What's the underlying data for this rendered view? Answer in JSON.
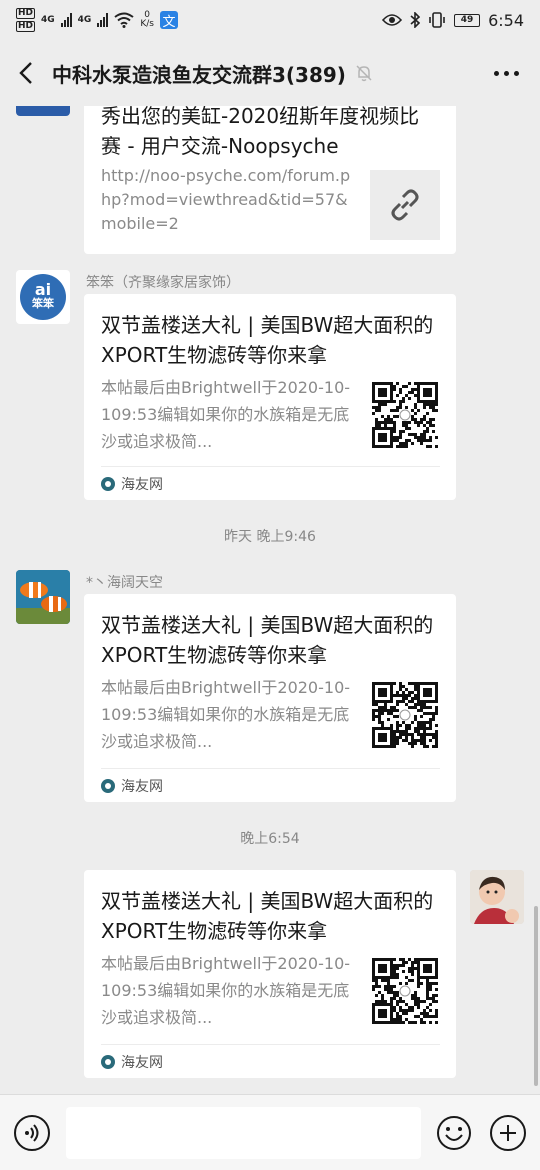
{
  "status_bar": {
    "hd1": "HD",
    "hd2": "HD",
    "net1": "4G",
    "net2": "4G",
    "speed_value": "0",
    "speed_unit": "K/s",
    "battery": "49",
    "time": "6:54"
  },
  "nav": {
    "title": "中科水泵造浪鱼友交流群3(389)"
  },
  "messages": [
    {
      "title": "秀出您的美缸-2020纽斯年度视频比赛 - 用户交流-Noopsyche",
      "desc": "http://noo-psyche.com/forum.php?mod=viewthread&tid=57&mobile=2"
    },
    {
      "sender": "笨笨（齐聚缘家居家饰）",
      "title": "双节盖楼送大礼 | 美国BW超大面积的XPORT生物滤砖等你来拿",
      "desc": "本帖最后由Brightwell于2020-10-109:53编辑如果你的水族箱是无底沙或追求极简...",
      "source": "海友网"
    },
    {
      "timestamp": "昨天 晚上9:46",
      "sender": "*丶海阔天空",
      "title": "双节盖楼送大礼 | 美国BW超大面积的XPORT生物滤砖等你来拿",
      "desc": "本帖最后由Brightwell于2020-10-109:53编辑如果你的水族箱是无底沙或追求极简...",
      "source": "海友网"
    },
    {
      "timestamp": "晚上6:54",
      "title": "双节盖楼送大礼 | 美国BW超大面积的XPORT生物滤砖等你来拿",
      "desc": "本帖最后由Brightwell于2020-10-109:53编辑如果你的水族箱是无底沙或追求极简...",
      "source": "海友网"
    }
  ],
  "avatar_text": "笨笨",
  "colors": {
    "background": "#ededed",
    "card": "#ffffff",
    "muted_text": "#888888"
  }
}
